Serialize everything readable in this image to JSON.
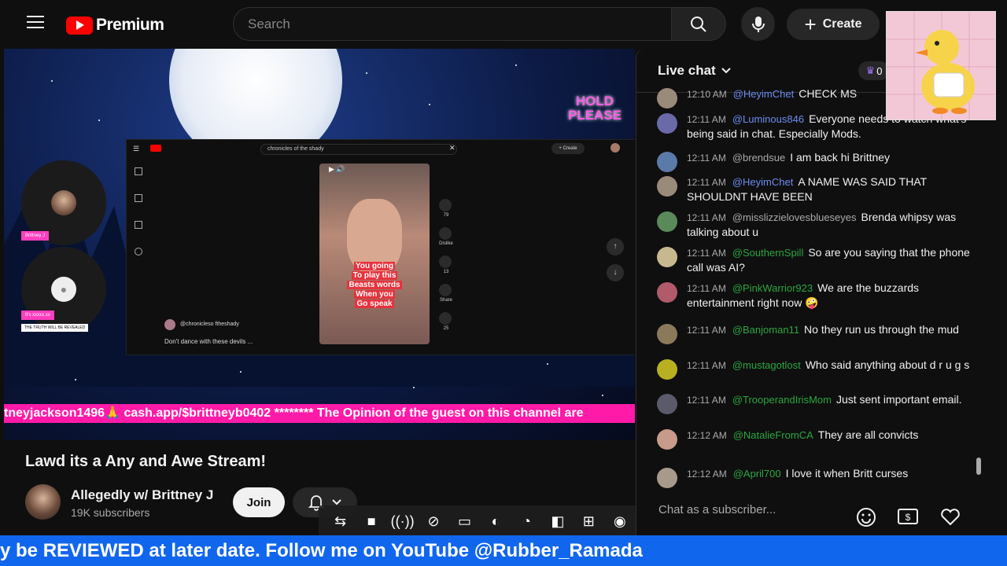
{
  "header": {
    "brand": "Premium",
    "search_placeholder": "Search",
    "create_label": "Create"
  },
  "video": {
    "hold_line1": "HOLD",
    "hold_line2": "PLEASE",
    "ticker": "tneyjackson1496🙏 cash.app/$brittneyb0402 ******** The Opinion of the guest on this channel are",
    "cam_tag_1": "Brittney J",
    "cam_tag_2": "It's xxxxx.xx",
    "cam_tag_3": "THE TRUTH WILL BE REVEALED",
    "inner": {
      "search_text": "chronicles of the shady",
      "create_label": "+ Create",
      "channel": "@chronicleso ftheshady",
      "desc": "Don't dance with these devils ...",
      "caption": [
        "You going",
        "To play this",
        "Beasts words",
        "When you",
        "Go speak"
      ],
      "like_count": "79",
      "comment_count": "13",
      "remix_count": "25",
      "dislike_label": "Dislike",
      "share_label": "Share"
    }
  },
  "stream": {
    "title": "Lawd its a Any and Awe Stream!",
    "channel_name": "Allegedly w/ Brittney J",
    "subscribers": "19K subscribers",
    "join_label": "Join"
  },
  "chat": {
    "title": "Live chat",
    "member_count": "0",
    "input_placeholder": "Chat as a subscriber...",
    "messages": [
      {
        "time": "12:10 AM",
        "author": "@HeyimChet",
        "text": "CHECK MS",
        "color": "blue",
        "avatar": "#9a8a7a"
      },
      {
        "time": "12:11 AM",
        "author": "@Luminous846",
        "text": "Everyone needs to watch what's being said in chat. Especially Mods.",
        "color": "blue",
        "avatar": "#6a6aa8"
      },
      {
        "time": "12:11 AM",
        "author": "@brendsue",
        "text": "I am back hi Brittney",
        "color": "grey",
        "avatar": "#5a7aa8"
      },
      {
        "time": "12:11 AM",
        "author": "@HeyimChet",
        "text": "A NAME WAS SAID THAT SHOULDNT HAVE BEEN",
        "color": "blue",
        "avatar": "#9a8a7a"
      },
      {
        "time": "12:11 AM",
        "author": "@misslizzielovesblueseyes",
        "text": "Brenda whipsy was talking about u",
        "color": "grey",
        "avatar": "#5a8a5a"
      },
      {
        "time": "12:11 AM",
        "author": "@SouthernSpill",
        "text": "So are you saying that the phone call was AI?",
        "color": "green",
        "avatar": "#c8b890"
      },
      {
        "time": "12:11 AM",
        "author": "@PinkWarrior923",
        "text": "We are the buzzards entertainment right now 🤪",
        "color": "green",
        "avatar": "#b05a6a"
      },
      {
        "time": "12:11 AM",
        "author": "@Banjoman11",
        "text": "No they run us through the mud",
        "color": "green",
        "avatar": "#8a7a5a"
      },
      {
        "time": "12:11 AM",
        "author": "@mustagotlost",
        "text": "Who said anything about d r u g s",
        "color": "green",
        "avatar": "#b8b020"
      },
      {
        "time": "12:11 AM",
        "author": "@TrooperandIrisMom",
        "text": "Just sent important email.",
        "color": "green",
        "avatar": "#5a5a6a"
      },
      {
        "time": "12:12 AM",
        "author": "@NatalieFromCA",
        "text": "They are all convicts",
        "color": "green",
        "avatar": "#c89a8a"
      },
      {
        "time": "12:12 AM",
        "author": "@April700",
        "text": "I love it when Britt curses",
        "color": "green",
        "avatar": "#a89a8a"
      }
    ]
  },
  "banner": {
    "text": "y be REVIEWED at later date. Follow me on YouTube @Rubber_Ramada"
  },
  "icons": {
    "menu": "menu-icon",
    "search": "search-icon",
    "mic": "mic-icon",
    "bell": "bell-icon",
    "emoji": "emoji-icon",
    "super_chat": "super-chat-icon",
    "heart": "heart-icon",
    "crown": "crown-icon"
  },
  "colors": {
    "youtube_red": "#ff0000",
    "ticker_pink": "#ff1aa8",
    "banner_blue": "#1166ee",
    "author_blue": "#6d8cf0",
    "author_green": "#2ba640"
  }
}
